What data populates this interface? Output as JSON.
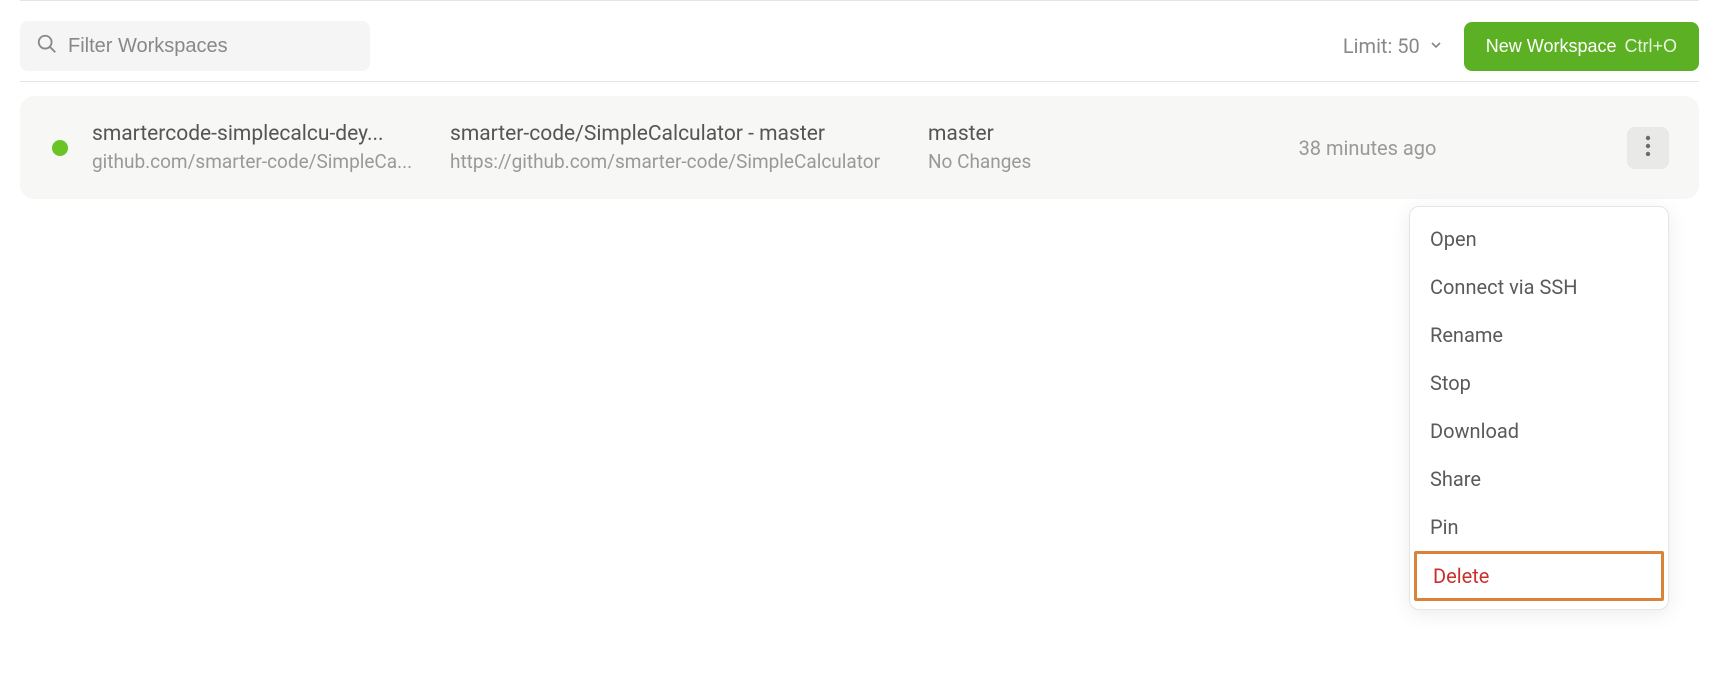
{
  "toolbar": {
    "filter_placeholder": "Filter Workspaces",
    "limit_label": "Limit: 50",
    "new_workspace_label": "New Workspace",
    "new_workspace_shortcut": "Ctrl+O"
  },
  "workspace": {
    "status_color": "#6ac423",
    "name": "smartercode-simplecalcu-dey...",
    "context_url": "github.com/smarter-code/SimpleCa...",
    "repo_display": "smarter-code/SimpleCalculator - master",
    "repo_url": "https://github.com/smarter-code/SimpleCalculator",
    "branch": "master",
    "changes": "No Changes",
    "last_active": "38 minutes ago"
  },
  "menu": {
    "items": [
      {
        "label": "Open",
        "danger": false,
        "highlighted": false
      },
      {
        "label": "Connect via SSH",
        "danger": false,
        "highlighted": false
      },
      {
        "label": "Rename",
        "danger": false,
        "highlighted": false
      },
      {
        "label": "Stop",
        "danger": false,
        "highlighted": false
      },
      {
        "label": "Download",
        "danger": false,
        "highlighted": false
      },
      {
        "label": "Share",
        "danger": false,
        "highlighted": false
      },
      {
        "label": "Pin",
        "danger": false,
        "highlighted": false
      },
      {
        "label": "Delete",
        "danger": true,
        "highlighted": true
      }
    ]
  }
}
